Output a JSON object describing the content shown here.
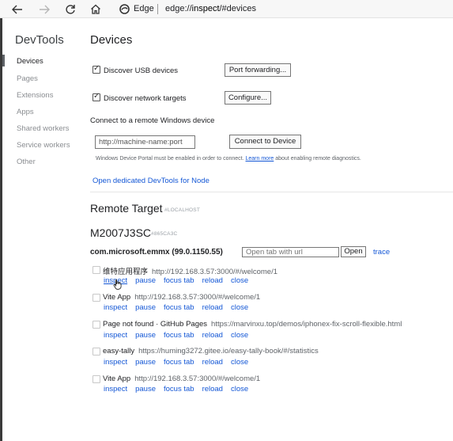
{
  "browser": {
    "edge_label": "Edge",
    "url_prefix": "edge://",
    "url_host": "inspect",
    "url_suffix": "/#devices"
  },
  "sidebar": {
    "title": "DevTools",
    "items": [
      {
        "label": "Devices",
        "active": true
      },
      {
        "label": "Pages"
      },
      {
        "label": "Extensions"
      },
      {
        "label": "Apps"
      },
      {
        "label": "Shared workers"
      },
      {
        "label": "Service workers"
      },
      {
        "label": "Other"
      }
    ]
  },
  "main": {
    "title": "Devices",
    "discover_usb": "Discover USB devices",
    "port_forwarding": "Port forwarding...",
    "discover_network": "Discover network targets",
    "configure": "Configure...",
    "connect_remote_title": "Connect to a remote Windows device",
    "machine_input_value": "http://machine-name:port",
    "connect_button": "Connect to Device",
    "portal_note_pre": "Windows Device Portal must be enabled in order to connect.",
    "portal_note_link": "Learn more",
    "portal_note_post": "about enabling remote diagnostics.",
    "open_node": "Open dedicated DevTools for Node"
  },
  "remote": {
    "title": "Remote Target",
    "tag": "#LOCALHOST",
    "device_name": "M2007J3SC",
    "device_id": "#865CA3C",
    "browser_name": "com.microsoft.emmx (99.0.1150.55)",
    "open_tab_placeholder": "Open tab with url",
    "open_button": "Open",
    "trace_link": "trace",
    "actions": [
      "inspect",
      "pause",
      "focus tab",
      "reload",
      "close"
    ],
    "pages": [
      {
        "title": "维特应用程序",
        "url": "http://192.168.3.57:3000/#/welcome/1"
      },
      {
        "title": "Vite App",
        "url": "http://192.168.3.57:3000/#/welcome/1"
      },
      {
        "title": "Page not found · GitHub Pages",
        "url": "https://marvinxu.top/demos/iphonex-fix-scroll-flexible.html"
      },
      {
        "title": "easy-tally",
        "url": "https://huming3272.gitee.io/easy-tally-book/#/statistics"
      },
      {
        "title": "Vite App",
        "url": "http://192.168.3.57:3000/#/welcome/1"
      }
    ]
  },
  "colors": {
    "link": "#1558d6",
    "text": "#202124",
    "muted": "#5f6368"
  }
}
